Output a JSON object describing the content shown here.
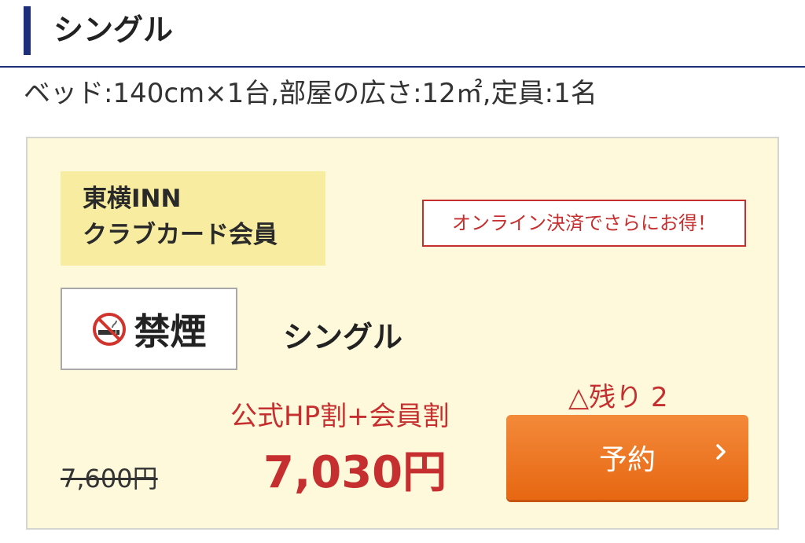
{
  "header": {
    "title": "シングル",
    "room_info": "ベッド:140cm×1台,部屋の広さ:12㎡,定員:1名"
  },
  "plan": {
    "member_badge": [
      "東横INN",
      "クラブカード会員"
    ],
    "online_notice": "オンライン決済でさらにお得！",
    "smoking": {
      "icon": "no-smoking-icon",
      "label": "禁煙"
    },
    "room_type": "シングル",
    "remaining": "△残り 2",
    "discount_label": "公式HP割+会員割",
    "price": "7,030円",
    "original_price": "7,600円",
    "reserve_label": "予約"
  },
  "colors": {
    "accent_navy": "#1d2f7a",
    "price_red": "#c62f2f",
    "button_orange": "#ef7a24",
    "card_bg": "#fdf9da",
    "badge_yellow": "#f7ec9f"
  }
}
